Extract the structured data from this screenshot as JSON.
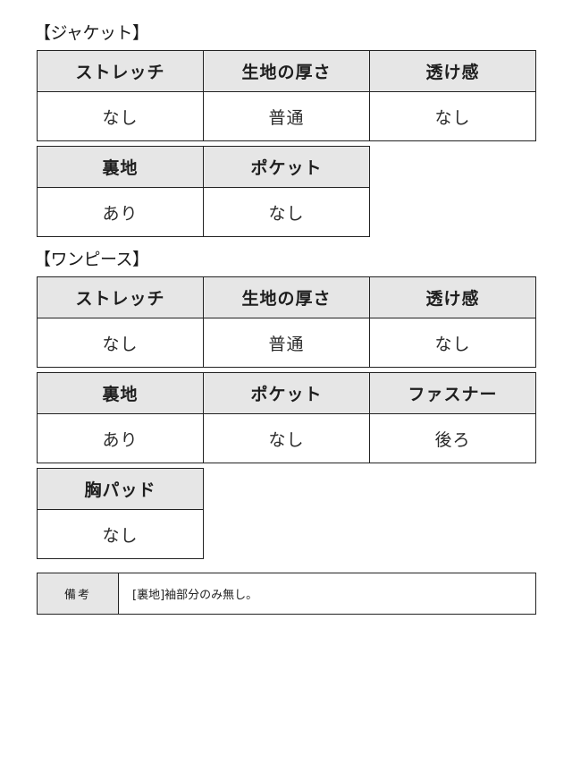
{
  "sections": [
    {
      "title": "【ジャケット】",
      "rows": [
        {
          "headers": [
            "ストレッチ",
            "生地の厚さ",
            "透け感"
          ],
          "values": [
            "なし",
            "普通",
            "なし"
          ]
        },
        {
          "headers": [
            "裏地",
            "ポケット"
          ],
          "values": [
            "あり",
            "なし"
          ]
        }
      ]
    },
    {
      "title": "【ワンピース】",
      "rows": [
        {
          "headers": [
            "ストレッチ",
            "生地の厚さ",
            "透け感"
          ],
          "values": [
            "なし",
            "普通",
            "なし"
          ]
        },
        {
          "headers": [
            "裏地",
            "ポケット",
            "ファスナー"
          ],
          "values": [
            "あり",
            "なし",
            "後ろ"
          ]
        },
        {
          "headers": [
            "胸パッド"
          ],
          "values": [
            "なし"
          ]
        }
      ]
    }
  ],
  "notes": {
    "label": "備考",
    "value": "[裏地]袖部分のみ無し。"
  }
}
